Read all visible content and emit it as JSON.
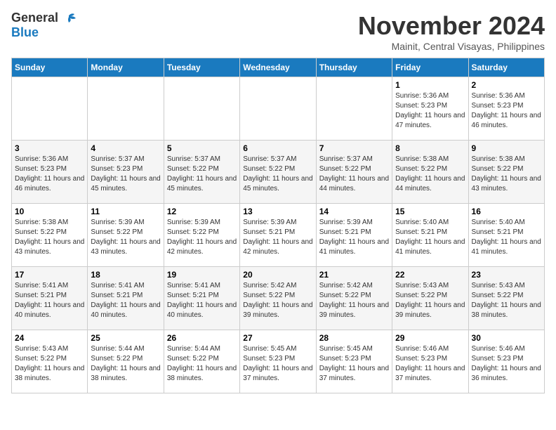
{
  "logo": {
    "line1": "General",
    "line2": "Blue"
  },
  "title": "November 2024",
  "subtitle": "Mainit, Central Visayas, Philippines",
  "weekdays": [
    "Sunday",
    "Monday",
    "Tuesday",
    "Wednesday",
    "Thursday",
    "Friday",
    "Saturday"
  ],
  "weeks": [
    [
      {
        "day": "",
        "info": ""
      },
      {
        "day": "",
        "info": ""
      },
      {
        "day": "",
        "info": ""
      },
      {
        "day": "",
        "info": ""
      },
      {
        "day": "",
        "info": ""
      },
      {
        "day": "1",
        "info": "Sunrise: 5:36 AM\nSunset: 5:23 PM\nDaylight: 11 hours and 47 minutes."
      },
      {
        "day": "2",
        "info": "Sunrise: 5:36 AM\nSunset: 5:23 PM\nDaylight: 11 hours and 46 minutes."
      }
    ],
    [
      {
        "day": "3",
        "info": "Sunrise: 5:36 AM\nSunset: 5:23 PM\nDaylight: 11 hours and 46 minutes."
      },
      {
        "day": "4",
        "info": "Sunrise: 5:37 AM\nSunset: 5:23 PM\nDaylight: 11 hours and 45 minutes."
      },
      {
        "day": "5",
        "info": "Sunrise: 5:37 AM\nSunset: 5:22 PM\nDaylight: 11 hours and 45 minutes."
      },
      {
        "day": "6",
        "info": "Sunrise: 5:37 AM\nSunset: 5:22 PM\nDaylight: 11 hours and 45 minutes."
      },
      {
        "day": "7",
        "info": "Sunrise: 5:37 AM\nSunset: 5:22 PM\nDaylight: 11 hours and 44 minutes."
      },
      {
        "day": "8",
        "info": "Sunrise: 5:38 AM\nSunset: 5:22 PM\nDaylight: 11 hours and 44 minutes."
      },
      {
        "day": "9",
        "info": "Sunrise: 5:38 AM\nSunset: 5:22 PM\nDaylight: 11 hours and 43 minutes."
      }
    ],
    [
      {
        "day": "10",
        "info": "Sunrise: 5:38 AM\nSunset: 5:22 PM\nDaylight: 11 hours and 43 minutes."
      },
      {
        "day": "11",
        "info": "Sunrise: 5:39 AM\nSunset: 5:22 PM\nDaylight: 11 hours and 43 minutes."
      },
      {
        "day": "12",
        "info": "Sunrise: 5:39 AM\nSunset: 5:22 PM\nDaylight: 11 hours and 42 minutes."
      },
      {
        "day": "13",
        "info": "Sunrise: 5:39 AM\nSunset: 5:21 PM\nDaylight: 11 hours and 42 minutes."
      },
      {
        "day": "14",
        "info": "Sunrise: 5:39 AM\nSunset: 5:21 PM\nDaylight: 11 hours and 41 minutes."
      },
      {
        "day": "15",
        "info": "Sunrise: 5:40 AM\nSunset: 5:21 PM\nDaylight: 11 hours and 41 minutes."
      },
      {
        "day": "16",
        "info": "Sunrise: 5:40 AM\nSunset: 5:21 PM\nDaylight: 11 hours and 41 minutes."
      }
    ],
    [
      {
        "day": "17",
        "info": "Sunrise: 5:41 AM\nSunset: 5:21 PM\nDaylight: 11 hours and 40 minutes."
      },
      {
        "day": "18",
        "info": "Sunrise: 5:41 AM\nSunset: 5:21 PM\nDaylight: 11 hours and 40 minutes."
      },
      {
        "day": "19",
        "info": "Sunrise: 5:41 AM\nSunset: 5:21 PM\nDaylight: 11 hours and 40 minutes."
      },
      {
        "day": "20",
        "info": "Sunrise: 5:42 AM\nSunset: 5:22 PM\nDaylight: 11 hours and 39 minutes."
      },
      {
        "day": "21",
        "info": "Sunrise: 5:42 AM\nSunset: 5:22 PM\nDaylight: 11 hours and 39 minutes."
      },
      {
        "day": "22",
        "info": "Sunrise: 5:43 AM\nSunset: 5:22 PM\nDaylight: 11 hours and 39 minutes."
      },
      {
        "day": "23",
        "info": "Sunrise: 5:43 AM\nSunset: 5:22 PM\nDaylight: 11 hours and 38 minutes."
      }
    ],
    [
      {
        "day": "24",
        "info": "Sunrise: 5:43 AM\nSunset: 5:22 PM\nDaylight: 11 hours and 38 minutes."
      },
      {
        "day": "25",
        "info": "Sunrise: 5:44 AM\nSunset: 5:22 PM\nDaylight: 11 hours and 38 minutes."
      },
      {
        "day": "26",
        "info": "Sunrise: 5:44 AM\nSunset: 5:22 PM\nDaylight: 11 hours and 38 minutes."
      },
      {
        "day": "27",
        "info": "Sunrise: 5:45 AM\nSunset: 5:23 PM\nDaylight: 11 hours and 37 minutes."
      },
      {
        "day": "28",
        "info": "Sunrise: 5:45 AM\nSunset: 5:23 PM\nDaylight: 11 hours and 37 minutes."
      },
      {
        "day": "29",
        "info": "Sunrise: 5:46 AM\nSunset: 5:23 PM\nDaylight: 11 hours and 37 minutes."
      },
      {
        "day": "30",
        "info": "Sunrise: 5:46 AM\nSunset: 5:23 PM\nDaylight: 11 hours and 36 minutes."
      }
    ]
  ]
}
